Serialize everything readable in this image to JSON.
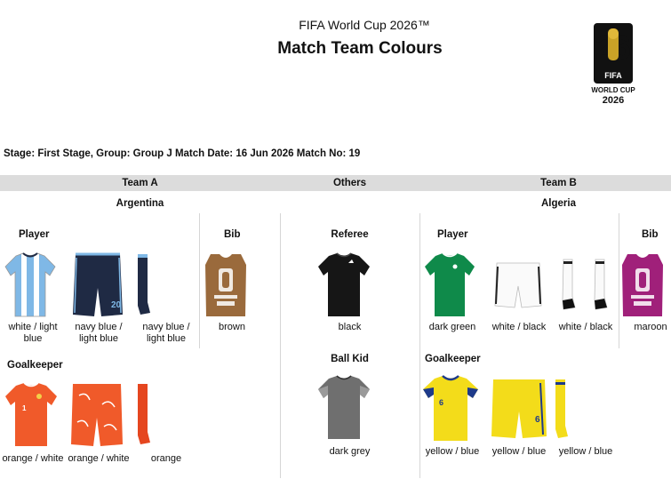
{
  "header": {
    "supertitle": "FIFA World Cup 2026™",
    "title": "Match Team Colours",
    "logo": {
      "text_top": "26",
      "text_fifa": "FIFA",
      "text_wc": "WORLD CUP",
      "text_year": "2026"
    }
  },
  "match_info": "Stage: First Stage,   Group: Group J   Match Date: 16 Jun 2026   Match No: 19",
  "columns": {
    "team_a": "Team A",
    "others": "Others",
    "team_b": "Team B"
  },
  "team_a": {
    "name": "Argentina",
    "player_label": "Player",
    "bib_label": "Bib",
    "goalkeeper_label": "Goalkeeper",
    "player": {
      "shirt": "white / light blue",
      "shorts": "navy blue / light blue",
      "socks": "navy blue / light blue"
    },
    "bib": "brown",
    "goalkeeper": {
      "shirt": "orange / white",
      "shorts": "orange / white",
      "socks": "orange"
    }
  },
  "others": {
    "referee_label": "Referee",
    "referee": "black",
    "ballkid_label": "Ball Kid",
    "ballkid": "dark grey"
  },
  "team_b": {
    "name": "Algeria",
    "player_label": "Player",
    "bib_label": "Bib",
    "goalkeeper_label": "Goalkeeper",
    "player": {
      "shirt": "dark green",
      "shorts": "white / black",
      "socks": "white / black"
    },
    "bib": "maroon",
    "goalkeeper": {
      "shirt": "yellow / blue",
      "shorts": "yellow / blue",
      "socks": "yellow / blue"
    }
  },
  "colors": {
    "header_bar": "#dcdcdc",
    "argentina_light_blue": "#7fb8e6",
    "argentina_navy": "#1f2a44",
    "gk_orange": "#f05a2a",
    "bib_brown": "#9a6a3c",
    "referee_black": "#161616",
    "ballkid_grey": "#6f6f6f",
    "algeria_green": "#0f8a4a",
    "bib_maroon": "#a0207a",
    "gk_yellow": "#f3dc1a",
    "gk_blue": "#1e3a8a"
  }
}
